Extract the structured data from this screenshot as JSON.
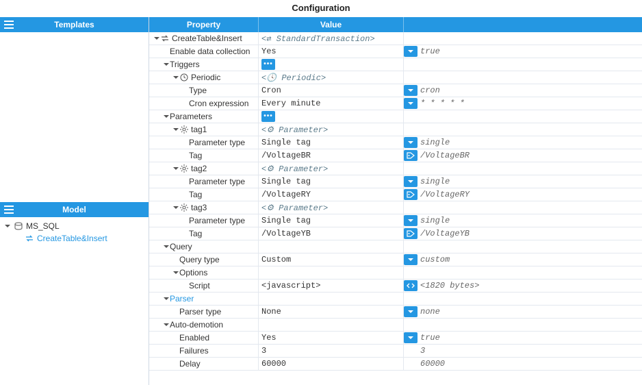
{
  "title": "Configuration",
  "panels": {
    "templates": "Templates",
    "model": "Model"
  },
  "model_tree": {
    "root": "MS_SQL",
    "child": "CreateTable&Insert"
  },
  "grid_headers": {
    "property": "Property",
    "value": "Value"
  },
  "rows": [
    {
      "indent": 0,
      "caret": true,
      "icon": "tx",
      "label": "CreateTable&Insert",
      "v1_type": "meta",
      "v1": "<⇄ StandardTransaction>",
      "v2_btn": "",
      "v2": ""
    },
    {
      "indent": 1,
      "caret": false,
      "icon": "",
      "label": "Enable data collection",
      "v1_type": "mono",
      "v1": "Yes",
      "v2_btn": "dd",
      "v2": "true"
    },
    {
      "indent": 1,
      "caret": true,
      "icon": "",
      "label": "Triggers",
      "v1_type": "btn-more",
      "v1": "",
      "v2_btn": "",
      "v2": ""
    },
    {
      "indent": 2,
      "caret": true,
      "icon": "clock",
      "label": "Periodic",
      "v1_type": "meta",
      "v1": "<🕓 Periodic>",
      "v2_btn": "",
      "v2": ""
    },
    {
      "indent": 3,
      "caret": false,
      "icon": "",
      "label": "Type",
      "v1_type": "mono",
      "v1": "Cron",
      "v2_btn": "dd",
      "v2": "cron"
    },
    {
      "indent": 3,
      "caret": false,
      "icon": "",
      "label": "Cron expression",
      "v1_type": "mono",
      "v1": "Every minute",
      "v2_btn": "dd",
      "v2": "* * * * *"
    },
    {
      "indent": 1,
      "caret": true,
      "icon": "",
      "label": "Parameters",
      "v1_type": "btn-more",
      "v1": "",
      "v2_btn": "",
      "v2": ""
    },
    {
      "indent": 2,
      "caret": true,
      "icon": "gear",
      "label": "tag1",
      "v1_type": "meta",
      "v1": "<⚙ Parameter>",
      "v2_btn": "",
      "v2": ""
    },
    {
      "indent": 3,
      "caret": false,
      "icon": "",
      "label": "Parameter type",
      "v1_type": "mono",
      "v1": "Single tag",
      "v2_btn": "dd",
      "v2": "single"
    },
    {
      "indent": 3,
      "caret": false,
      "icon": "",
      "label": "Tag",
      "v1_type": "mono",
      "v1": "/VoltageBR",
      "v2_btn": "tag",
      "v2": "/VoltageBR"
    },
    {
      "indent": 2,
      "caret": true,
      "icon": "gear",
      "label": "tag2",
      "v1_type": "meta",
      "v1": "<⚙ Parameter>",
      "v2_btn": "",
      "v2": ""
    },
    {
      "indent": 3,
      "caret": false,
      "icon": "",
      "label": "Parameter type",
      "v1_type": "mono",
      "v1": "Single tag",
      "v2_btn": "dd",
      "v2": "single"
    },
    {
      "indent": 3,
      "caret": false,
      "icon": "",
      "label": "Tag",
      "v1_type": "mono",
      "v1": "/VoltageRY",
      "v2_btn": "tag",
      "v2": "/VoltageRY"
    },
    {
      "indent": 2,
      "caret": true,
      "icon": "gear",
      "label": "tag3",
      "v1_type": "meta",
      "v1": "<⚙ Parameter>",
      "v2_btn": "",
      "v2": ""
    },
    {
      "indent": 3,
      "caret": false,
      "icon": "",
      "label": "Parameter type",
      "v1_type": "mono",
      "v1": "Single tag",
      "v2_btn": "dd",
      "v2": "single"
    },
    {
      "indent": 3,
      "caret": false,
      "icon": "",
      "label": "Tag",
      "v1_type": "mono",
      "v1": "/VoltageYB",
      "v2_btn": "tag",
      "v2": "/VoltageYB"
    },
    {
      "indent": 1,
      "caret": true,
      "icon": "",
      "label": "Query",
      "v1_type": "",
      "v1": "",
      "v2_btn": "",
      "v2": ""
    },
    {
      "indent": 2,
      "caret": false,
      "icon": "",
      "label": "Query type",
      "v1_type": "mono",
      "v1": "Custom",
      "v2_btn": "dd",
      "v2": "custom"
    },
    {
      "indent": 2,
      "caret": true,
      "icon": "",
      "label": "Options",
      "v1_type": "",
      "v1": "",
      "v2_btn": "",
      "v2": ""
    },
    {
      "indent": 3,
      "caret": false,
      "icon": "",
      "label": "Script",
      "v1_type": "mono",
      "v1": "<javascript>",
      "v2_btn": "code",
      "v2": "<1820 bytes>"
    },
    {
      "indent": 1,
      "caret": true,
      "icon": "",
      "label": "Parser",
      "link": true,
      "v1_type": "",
      "v1": "",
      "v2_btn": "",
      "v2": ""
    },
    {
      "indent": 2,
      "caret": false,
      "icon": "",
      "label": "Parser type",
      "v1_type": "mono",
      "v1": "None",
      "v2_btn": "dd",
      "v2": "none"
    },
    {
      "indent": 1,
      "caret": true,
      "icon": "",
      "label": "Auto-demotion",
      "v1_type": "",
      "v1": "",
      "v2_btn": "",
      "v2": ""
    },
    {
      "indent": 2,
      "caret": false,
      "icon": "",
      "label": "Enabled",
      "v1_type": "mono",
      "v1": "Yes",
      "v2_btn": "dd",
      "v2": "true"
    },
    {
      "indent": 2,
      "caret": false,
      "icon": "",
      "label": "Failures",
      "v1_type": "mono",
      "v1": "3",
      "v2_btn": "",
      "v2": "3"
    },
    {
      "indent": 2,
      "caret": false,
      "icon": "",
      "label": "Delay",
      "v1_type": "mono",
      "v1": "60000",
      "v2_btn": "",
      "v2": "60000"
    }
  ]
}
